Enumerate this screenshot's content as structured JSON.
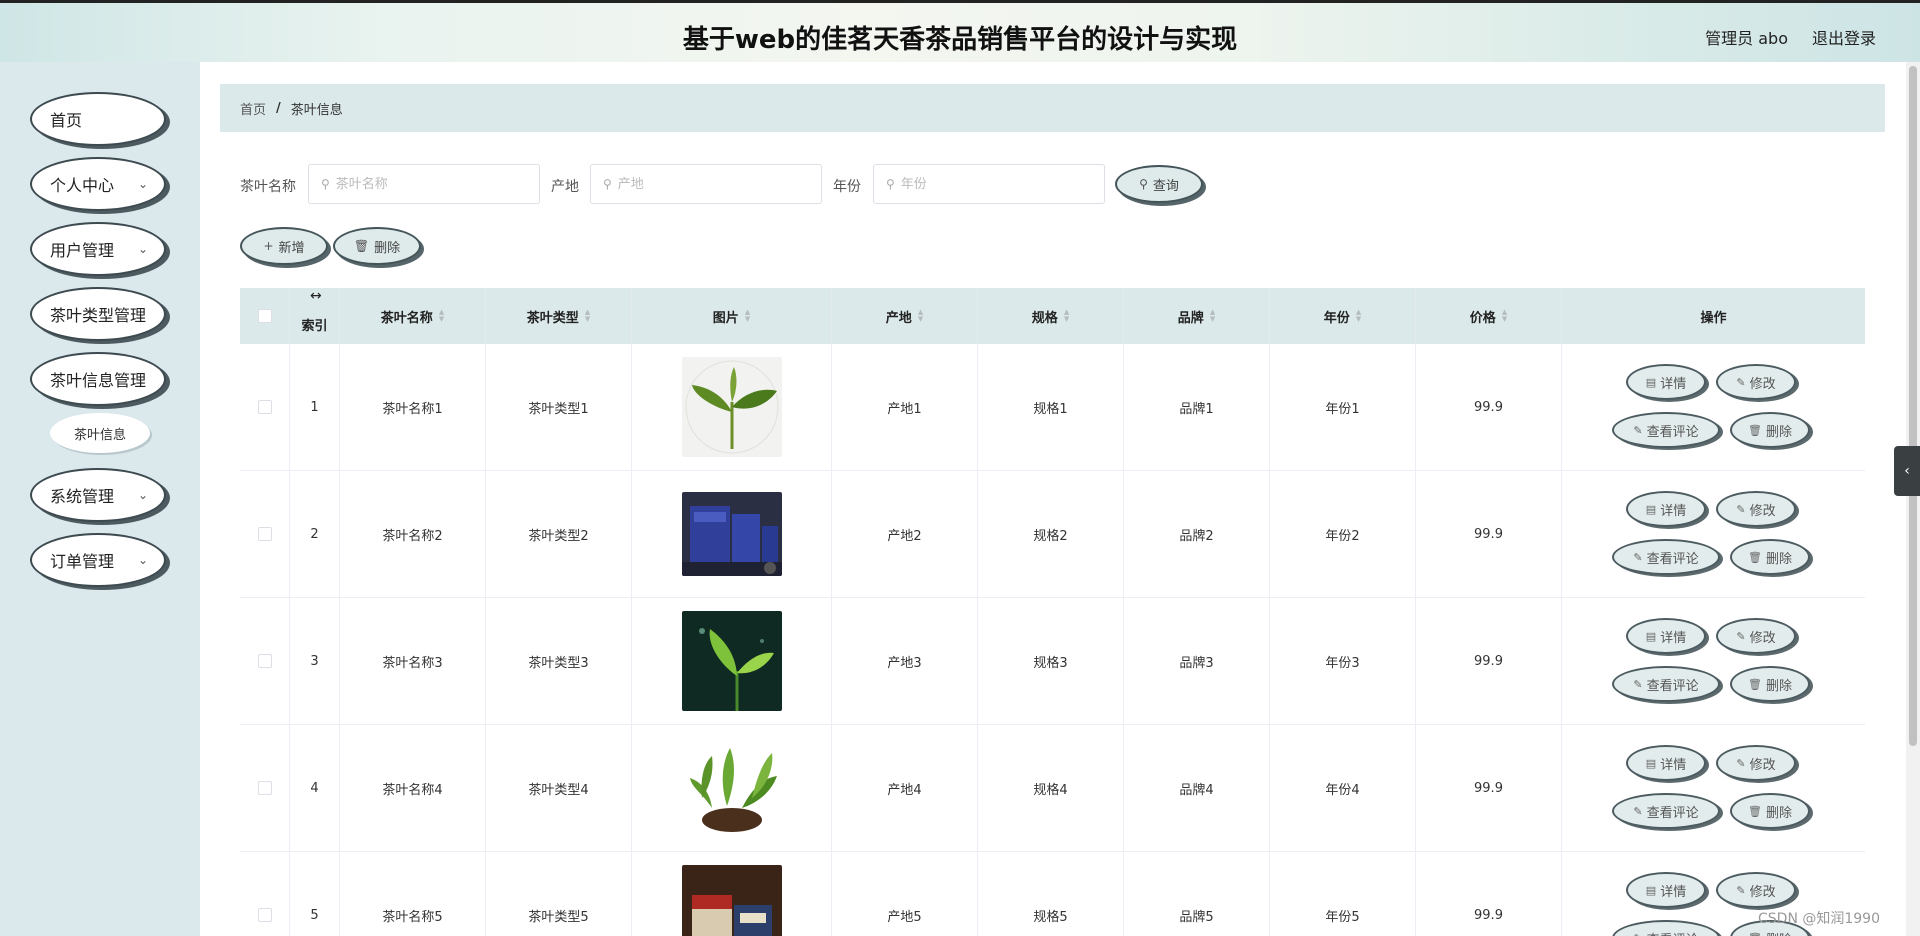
{
  "header": {
    "title": "基于web的佳茗天香茶品销售平台的设计与实现",
    "user": "管理员 abo",
    "logout": "退出登录"
  },
  "sidebar": {
    "items": [
      {
        "label": "首页",
        "has_children": false
      },
      {
        "label": "个人中心",
        "has_children": true
      },
      {
        "label": "用户管理",
        "has_children": true
      },
      {
        "label": "茶叶类型管理",
        "has_children": false
      },
      {
        "label": "茶叶信息管理",
        "has_children": false
      },
      {
        "label": "系统管理",
        "has_children": true
      },
      {
        "label": "订单管理",
        "has_children": true
      }
    ],
    "sub_item": "茶叶信息"
  },
  "breadcrumb": {
    "home": "首页",
    "sep": "/",
    "current": "茶叶信息"
  },
  "search": {
    "name_label": "茶叶名称",
    "name_placeholder": "茶叶名称",
    "origin_label": "产地",
    "origin_placeholder": "产地",
    "year_label": "年份",
    "year_placeholder": "年份",
    "query_button": "查询"
  },
  "actions": {
    "add": "新增",
    "delete": "删除"
  },
  "table": {
    "columns": [
      "索引",
      "茶叶名称",
      "茶叶类型",
      "图片",
      "产地",
      "规格",
      "品牌",
      "年份",
      "价格",
      "操作"
    ],
    "rows": [
      {
        "index": "1",
        "name": "茶叶名称1",
        "type": "茶叶类型1",
        "origin": "产地1",
        "spec": "规格1",
        "brand": "品牌1",
        "year": "年份1",
        "price": "99.9"
      },
      {
        "index": "2",
        "name": "茶叶名称2",
        "type": "茶叶类型2",
        "origin": "产地2",
        "spec": "规格2",
        "brand": "品牌2",
        "year": "年份2",
        "price": "99.9"
      },
      {
        "index": "3",
        "name": "茶叶名称3",
        "type": "茶叶类型3",
        "origin": "产地3",
        "spec": "规格3",
        "brand": "品牌3",
        "year": "年份3",
        "price": "99.9"
      },
      {
        "index": "4",
        "name": "茶叶名称4",
        "type": "茶叶类型4",
        "origin": "产地4",
        "spec": "规格4",
        "brand": "品牌4",
        "year": "年份4",
        "price": "99.9"
      },
      {
        "index": "5",
        "name": "茶叶名称5",
        "type": "茶叶类型5",
        "origin": "产地5",
        "spec": "规格5",
        "brand": "品牌5",
        "year": "年份5",
        "price": "99.9"
      }
    ],
    "row_actions": {
      "detail": "详情",
      "edit": "修改",
      "comments": "查看评论",
      "delete": "删除"
    }
  },
  "watermark": "CSDN @知润1990"
}
